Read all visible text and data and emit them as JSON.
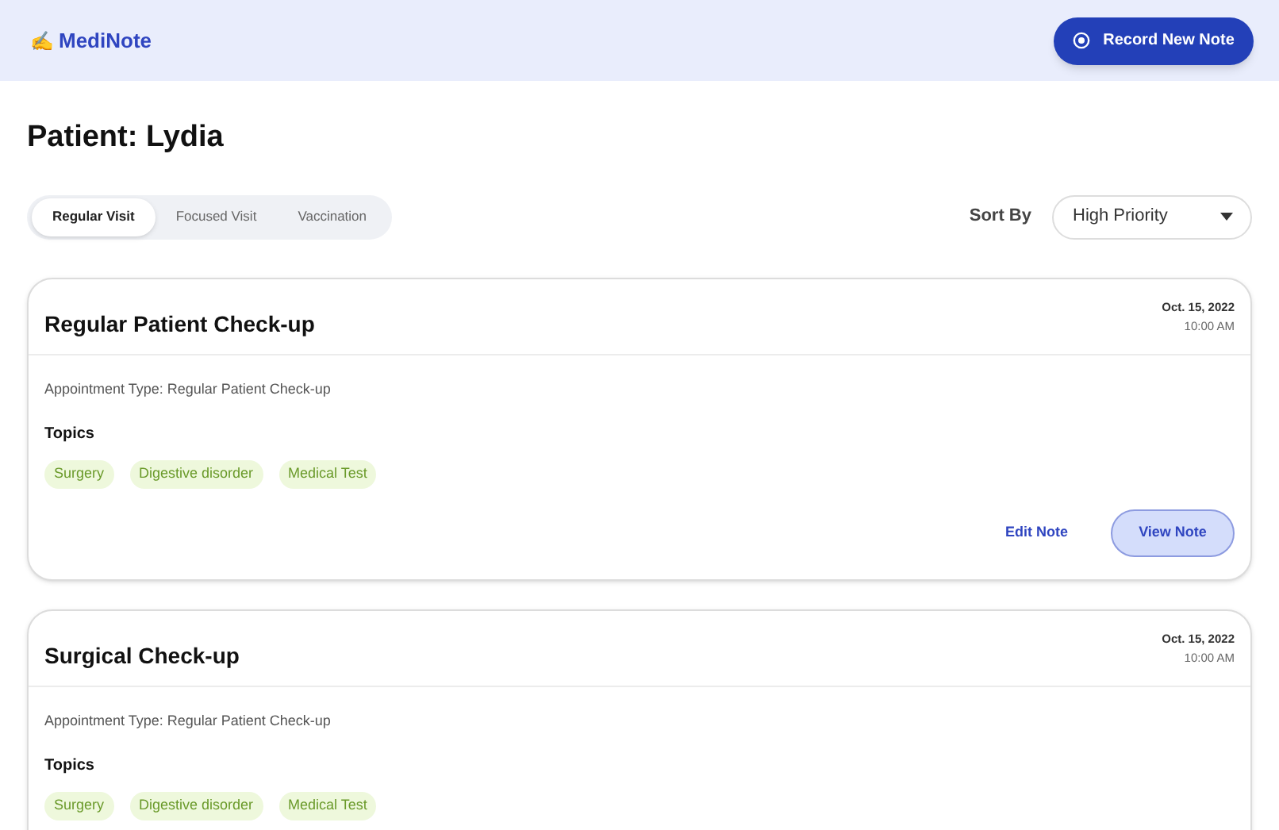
{
  "header": {
    "logo_mark": "✍",
    "app_name": "MediNote",
    "record_button": "Record New Note"
  },
  "patient_title": "Patient: Lydia",
  "tabs": [
    {
      "label": "Regular Visit",
      "selected": true
    },
    {
      "label": "Focused Visit",
      "selected": false
    },
    {
      "label": "Vaccination",
      "selected": false
    }
  ],
  "sort": {
    "label": "Sort By",
    "value": "High Priority"
  },
  "notes": [
    {
      "title": "Regular Patient Check-up",
      "date": "Oct. 15, 2022",
      "time": "10:00 AM",
      "appointment": "Appointment Type: Regular Patient Check-up",
      "topics_label": "Topics",
      "topics": [
        "Surgery",
        "Digestive disorder",
        "Medical Test"
      ],
      "actions": {
        "edit": "Edit Note",
        "view": "View Note"
      }
    },
    {
      "title": "Surgical Check-up",
      "date": "Oct. 15, 2022",
      "time": "10:00 AM",
      "appointment": "Appointment Type: Regular Patient Check-up",
      "topics_label": "Topics",
      "topics": [
        "Surgery",
        "Digestive disorder",
        "Medical Test"
      ]
    }
  ]
}
